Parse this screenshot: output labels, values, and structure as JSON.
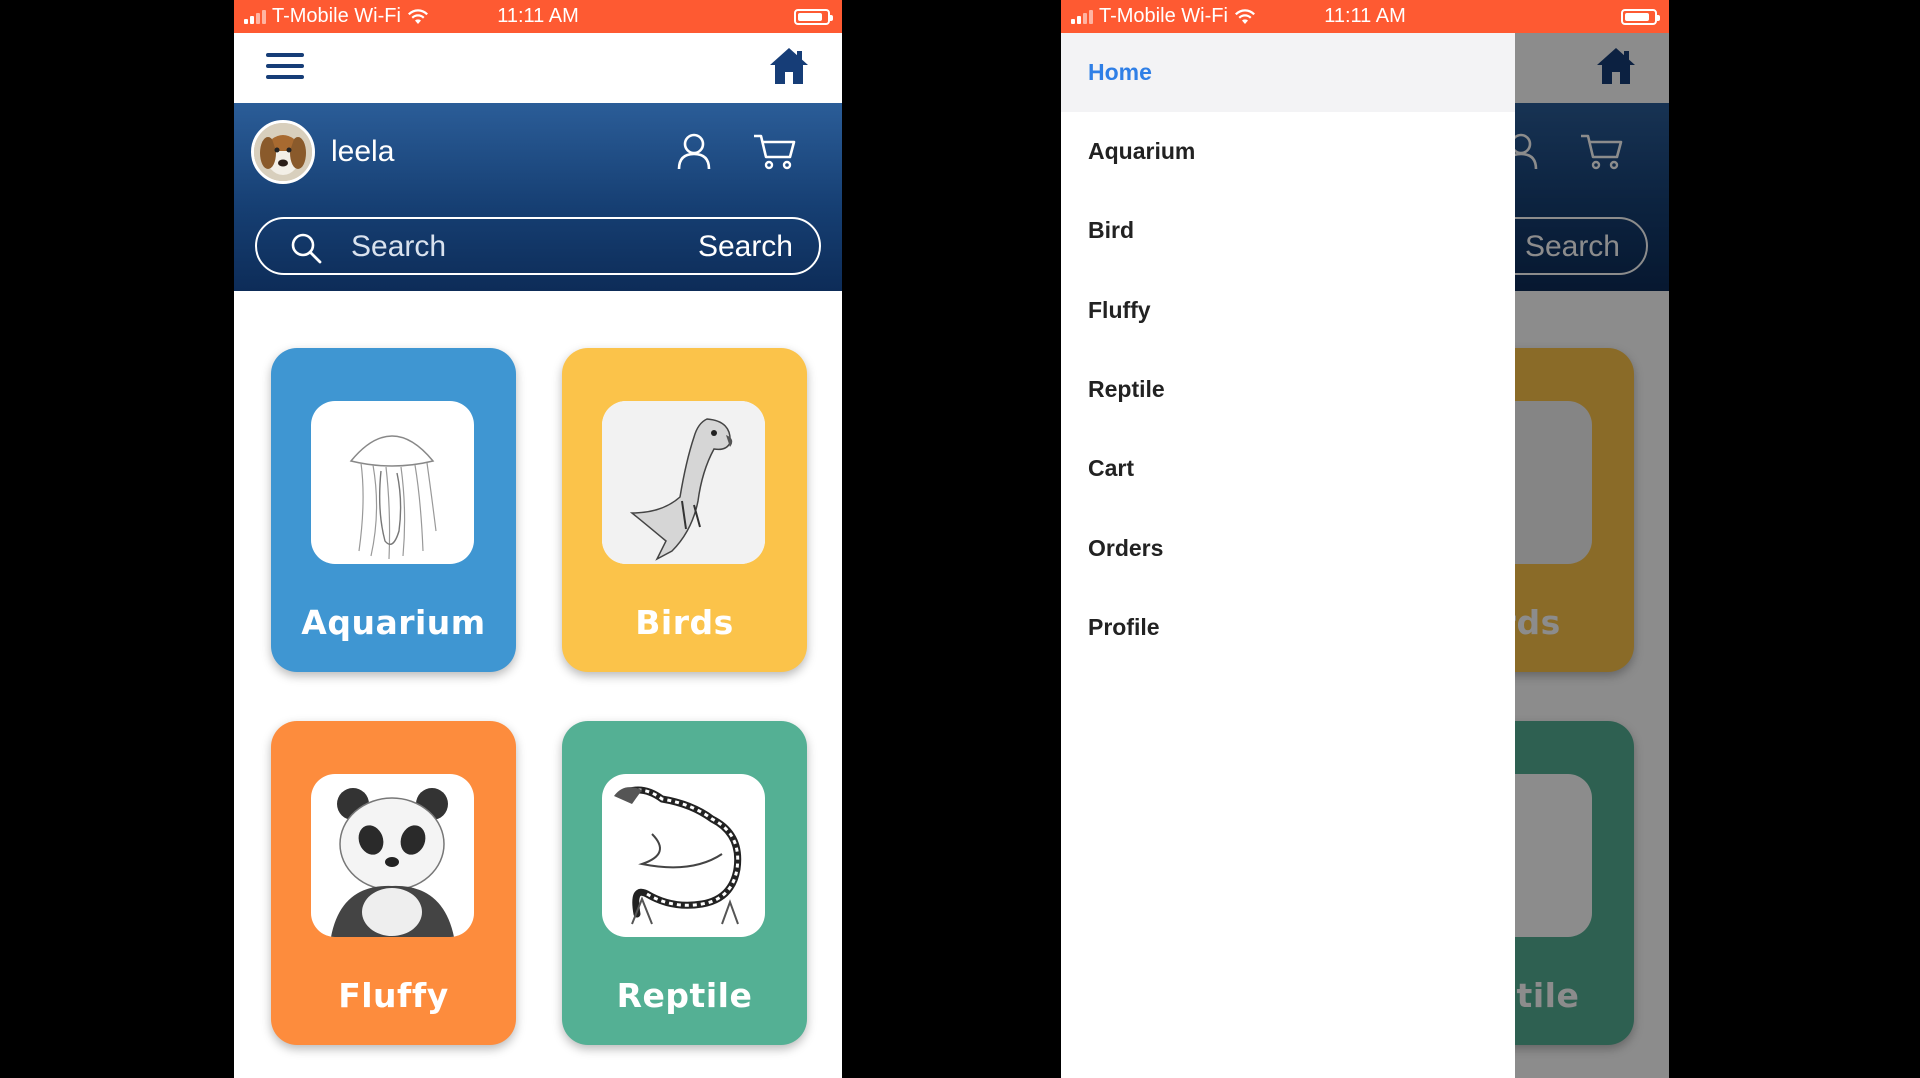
{
  "status_bar": {
    "carrier": "T-Mobile Wi-Fi",
    "time": "11:11 AM"
  },
  "user": {
    "name": "leela"
  },
  "search": {
    "placeholder": "Search",
    "button_label": "Search"
  },
  "categories": [
    {
      "label": "Aquarium",
      "color": "#3f96d2",
      "image": "jellyfish-sketch"
    },
    {
      "label": "Birds",
      "color": "#fbc34a",
      "image": "parrot-sketch"
    },
    {
      "label": "Fluffy",
      "color": "#fd8c3d",
      "image": "panda-sketch"
    },
    {
      "label": "Reptile",
      "color": "#54b094",
      "image": "iguana-sketch"
    }
  ],
  "drawer": {
    "items": [
      {
        "label": "Home",
        "active": true
      },
      {
        "label": "Aquarium"
      },
      {
        "label": "Bird"
      },
      {
        "label": "Fluffy"
      },
      {
        "label": "Reptile"
      },
      {
        "label": "Cart"
      },
      {
        "label": "Orders"
      },
      {
        "label": "Profile"
      }
    ]
  },
  "colors": {
    "status_bar": "#fe5a32",
    "header_navy": "#163f73",
    "accent_blue": "#2f7fe6"
  },
  "icons": [
    "hamburger-icon",
    "home-icon",
    "profile-icon",
    "cart-icon",
    "search-icon",
    "wifi-icon",
    "battery-icon"
  ]
}
